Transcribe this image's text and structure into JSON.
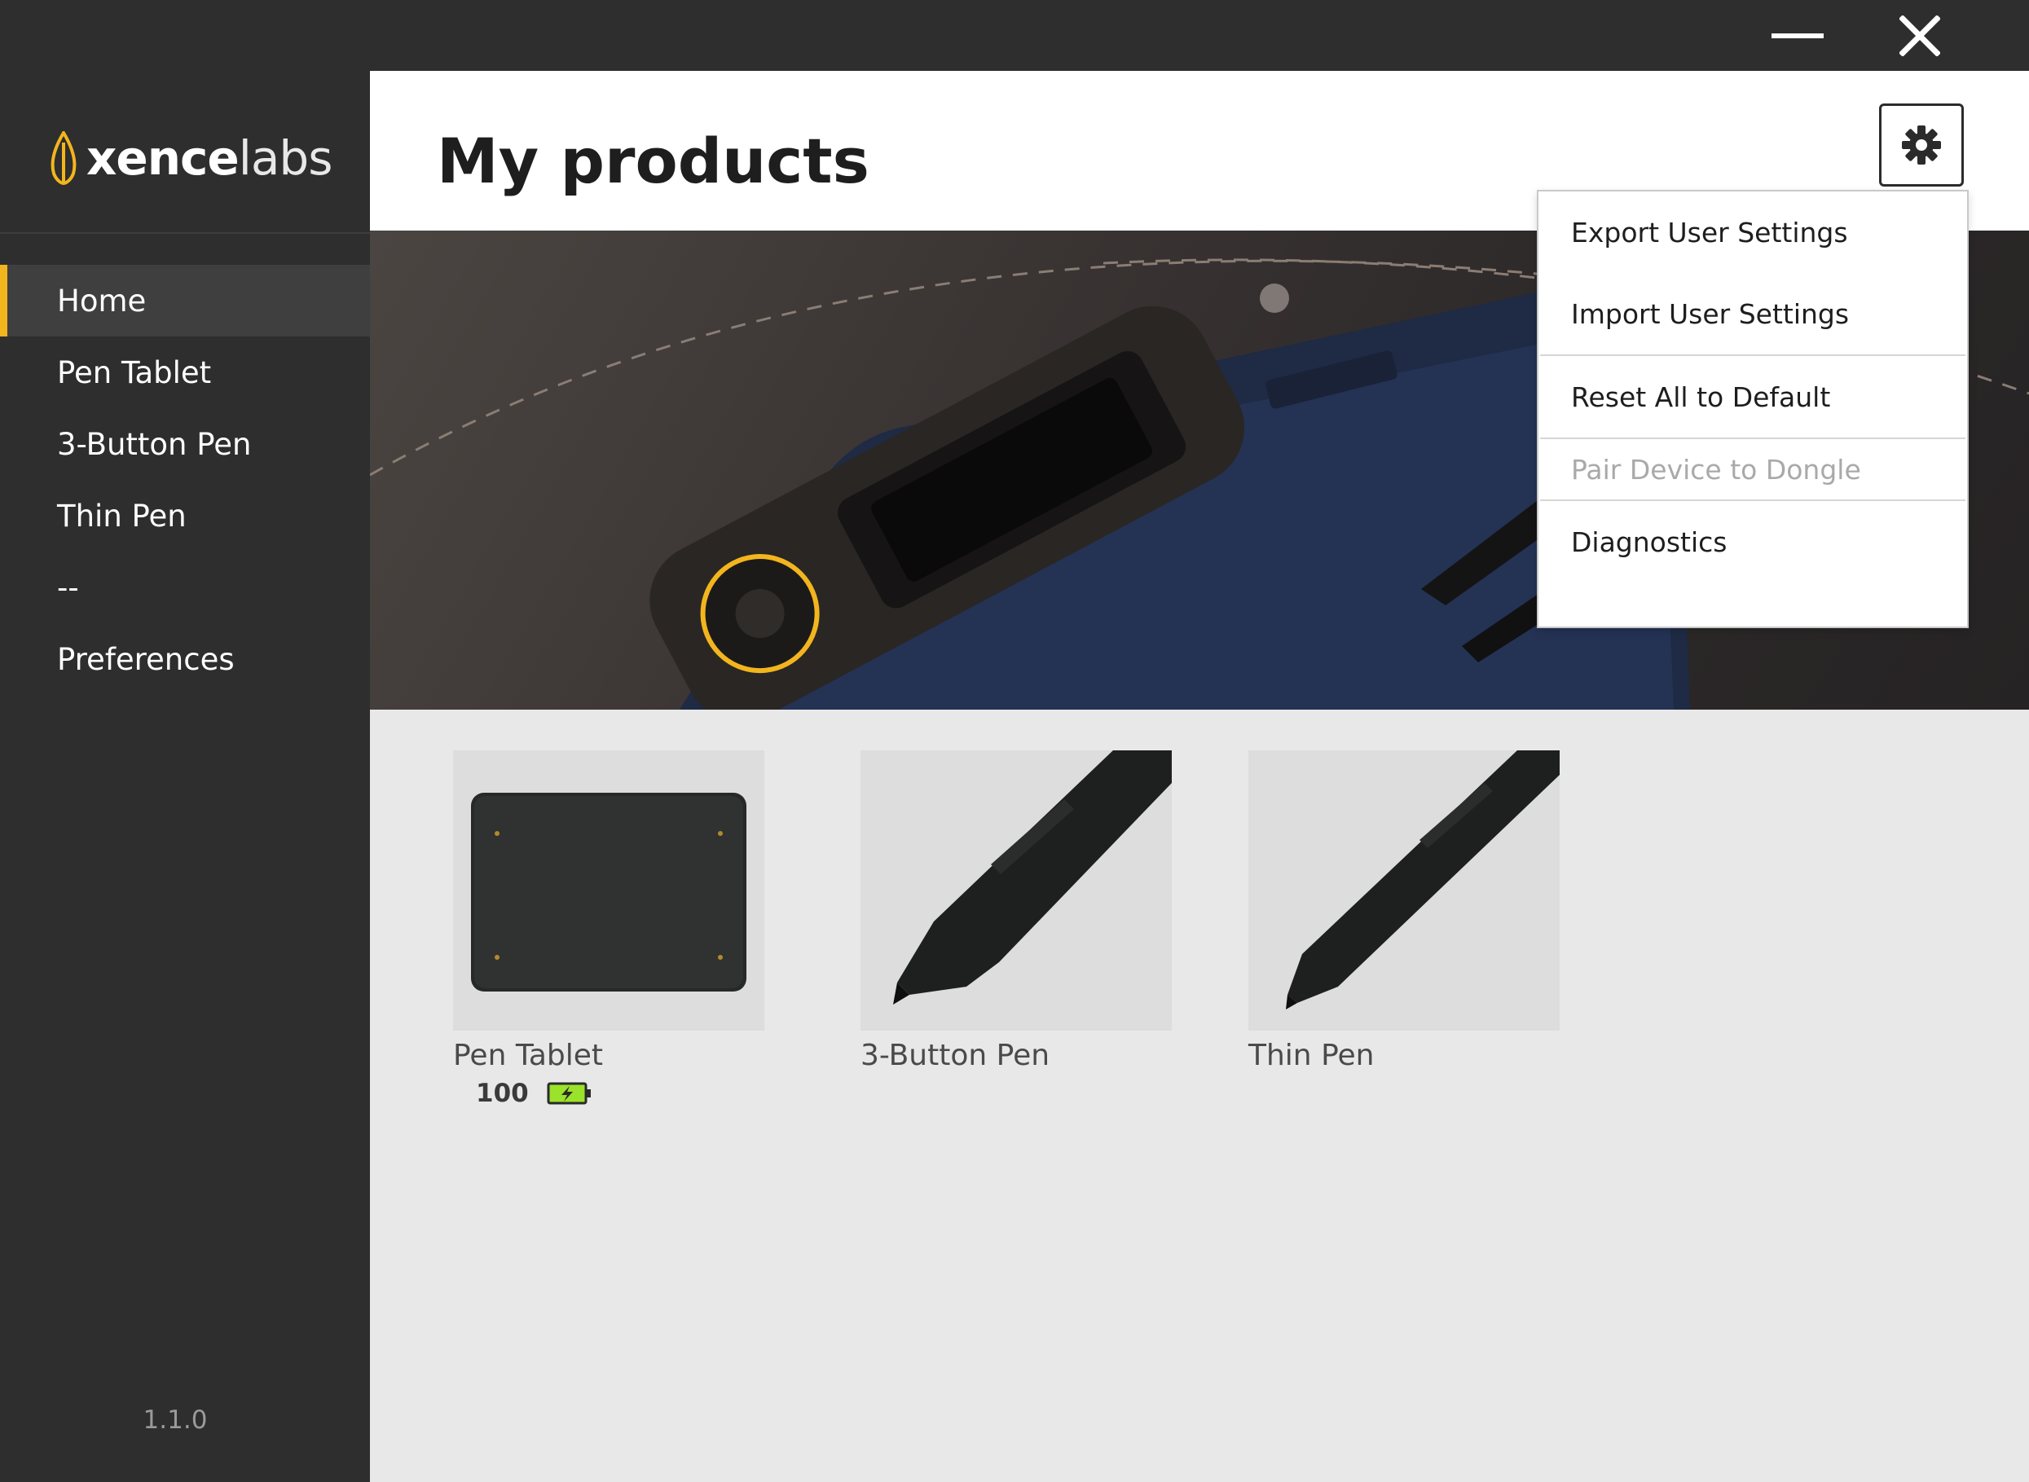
{
  "window": {
    "minimize_icon": "minimize-icon",
    "close_icon": "close-icon"
  },
  "sidebar": {
    "logo": {
      "bold": "xence",
      "light": "labs"
    },
    "items": [
      {
        "label": "Home",
        "active": true
      },
      {
        "label": "Pen Tablet",
        "active": false
      },
      {
        "label": "3-Button Pen",
        "active": false
      },
      {
        "label": "Thin Pen",
        "active": false
      },
      {
        "label": "--",
        "active": false
      },
      {
        "label": "Preferences",
        "active": false
      }
    ],
    "version": "1.1.0"
  },
  "header": {
    "title": "My products",
    "settings_icon": "gear-icon"
  },
  "settings_menu": {
    "items": [
      {
        "label": "Export User Settings",
        "enabled": true
      },
      {
        "label": "Import User Settings",
        "enabled": true
      },
      {
        "label": "Reset All to Default",
        "enabled": true
      },
      {
        "label": "Pair Device to Dongle",
        "enabled": false
      },
      {
        "label": "Diagnostics",
        "enabled": true
      }
    ]
  },
  "products": [
    {
      "name": "Pen Tablet",
      "battery": "100",
      "battery_icon": "battery-charging-icon"
    },
    {
      "name": "3-Button Pen"
    },
    {
      "name": "Thin Pen"
    }
  ],
  "colors": {
    "accent": "#f2b51d",
    "sidebar_bg": "#2e2e2e",
    "battery_green": "#9be22b"
  }
}
